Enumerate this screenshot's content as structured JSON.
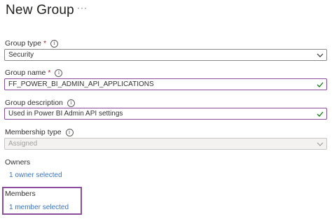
{
  "header": {
    "title": "New Group",
    "more_label": "···"
  },
  "group_type": {
    "label": "Group type",
    "required_mark": "*",
    "value": "Security"
  },
  "group_name": {
    "label": "Group name",
    "required_mark": "*",
    "value": "FF_POWER_BI_ADMIN_API_APPLICATIONS"
  },
  "group_description": {
    "label": "Group description",
    "value": "Used in Power BI Admin API settings"
  },
  "membership_type": {
    "label": "Membership type",
    "value": "Assigned"
  },
  "owners": {
    "label": "Owners",
    "link": "1 owner selected"
  },
  "members": {
    "label": "Members",
    "link": "1 member selected"
  },
  "icons": {
    "info": "info-icon",
    "chevron": "chevron-down-icon",
    "check": "checkmark-icon",
    "more": "more-icon"
  },
  "colors": {
    "link": "#3b74c2",
    "highlight": "#8a4e9c",
    "required": "#a4262c"
  }
}
